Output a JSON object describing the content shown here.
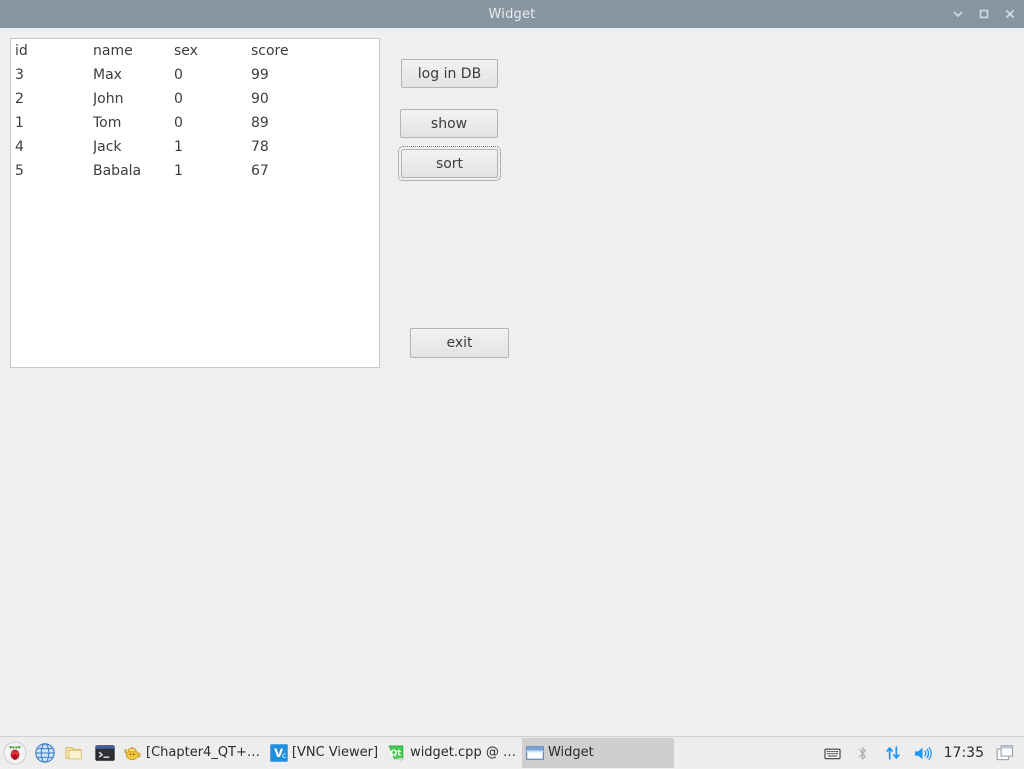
{
  "window": {
    "title": "Widget",
    "controls": [
      {
        "name": "minimize",
        "icon": "chevron-down-icon"
      },
      {
        "name": "maximize",
        "icon": "square-icon"
      },
      {
        "name": "close",
        "icon": "close-icon"
      }
    ],
    "titlebar_color": "#8795a1",
    "background_color": "#efefef"
  },
  "table": {
    "headers": [
      "id",
      "name",
      "sex",
      "score"
    ],
    "rows": [
      [
        "3",
        "Max",
        "0",
        "99"
      ],
      [
        "2",
        "John",
        "0",
        "90"
      ],
      [
        "1",
        "Tom",
        "0",
        "89"
      ],
      [
        "4",
        "Jack",
        "1",
        "78"
      ],
      [
        "5",
        "Babala",
        "1",
        "67"
      ]
    ]
  },
  "buttons": {
    "login": "log in DB",
    "show": "show",
    "sort": "sort",
    "exit": "exit"
  },
  "taskbar": {
    "launchers": [
      {
        "name": "raspberry-menu-icon"
      },
      {
        "name": "web-browser-icon"
      },
      {
        "name": "file-manager-icon"
      },
      {
        "name": "terminal-icon"
      }
    ],
    "windows": [
      {
        "label": "[Chapter4_QT+…",
        "icon": "teapot-icon",
        "active": false
      },
      {
        "label": "[VNC Viewer]",
        "icon": "vnc-icon",
        "active": false
      },
      {
        "label": "widget.cpp @ …",
        "icon": "qt-icon",
        "active": false
      },
      {
        "label": "Widget",
        "icon": "window-icon",
        "active": true
      }
    ],
    "tray": [
      {
        "name": "keyboard-icon"
      },
      {
        "name": "bluetooth-icon"
      },
      {
        "name": "network-icon"
      },
      {
        "name": "volume-icon"
      }
    ],
    "clock": "17:35",
    "show_desktop": {
      "name": "show-desktop-icon"
    }
  }
}
